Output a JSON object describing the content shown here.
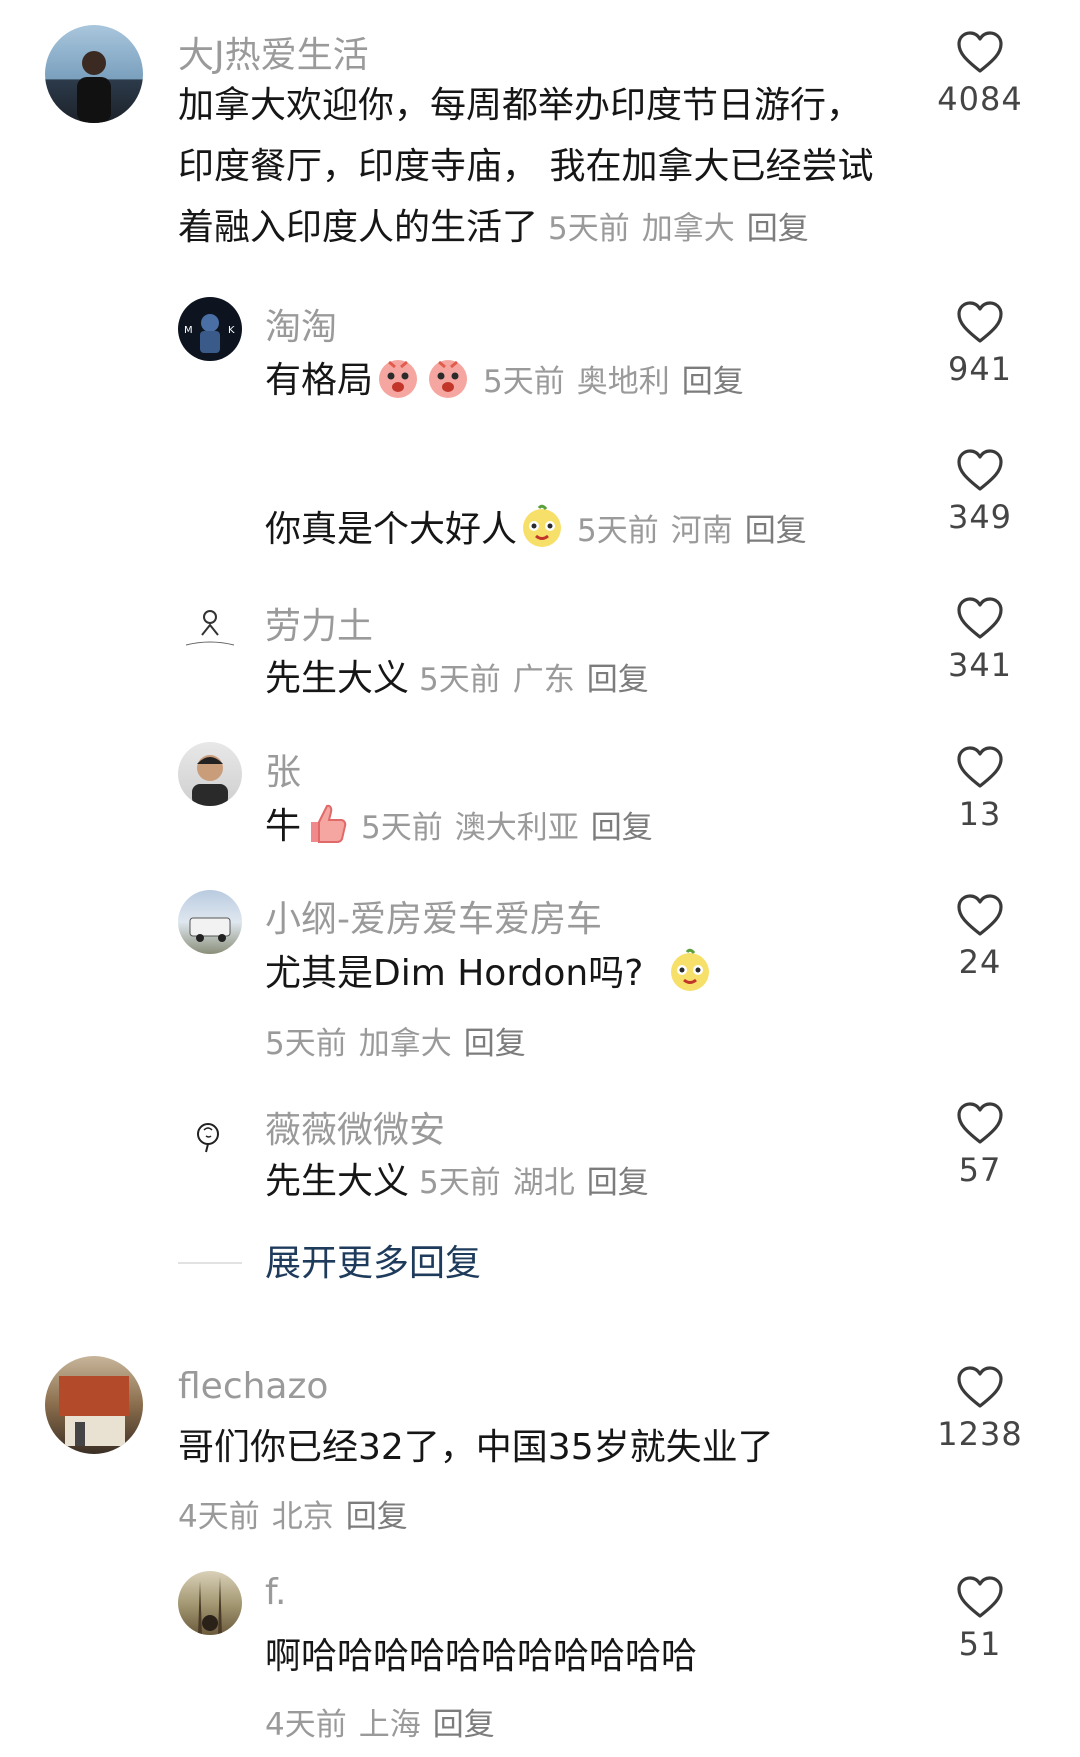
{
  "comments": [
    {
      "user": "大J热爱生活",
      "lines": [
        "加拿大欢迎你，每周都举办印度节日游行，",
        "印度餐厅，印度寺庙， 我在加拿大已经尝试",
        "着融入印度人的生活了"
      ],
      "time": "5天前",
      "location": "加拿大",
      "reply": "回复",
      "likes": "4084",
      "avatar_icon": "man-by-sea-avatar"
    },
    {
      "user": "淘淘",
      "text": "有格局",
      "emojis": [
        "angry-face-emoji",
        "angry-face-emoji"
      ],
      "time": "5天前",
      "location": "奥地利",
      "reply": "回复",
      "likes": "941",
      "avatar_icon": "soldier-mk-avatar"
    },
    {
      "user": "",
      "text": "你真是个大好人",
      "emojis": [
        "smug-face-emoji"
      ],
      "time": "5天前",
      "location": "河南",
      "reply": "回复",
      "likes": "349"
    },
    {
      "user": "劳力土",
      "text": "先生大义",
      "time": "5天前",
      "location": "广东",
      "reply": "回复",
      "likes": "341",
      "avatar_icon": "sketch-figure-avatar"
    },
    {
      "user": "张",
      "text": "牛",
      "emojis": [
        "thumbs-up-emoji"
      ],
      "time": "5天前",
      "location": "澳大利亚",
      "reply": "回复",
      "likes": "13",
      "avatar_icon": "man-portrait-avatar"
    },
    {
      "user": "小纲-爱房爱车爱房车",
      "text": "尤其是Dim Hordon吗?",
      "emojis": [
        "smug-face-emoji"
      ],
      "time": "5天前",
      "location": "加拿大",
      "reply": "回复",
      "likes": "24",
      "avatar_icon": "rv-truck-avatar"
    },
    {
      "user": "薇薇微微安",
      "text": "先生大义",
      "time": "5天前",
      "location": "湖北",
      "reply": "回复",
      "likes": "57",
      "avatar_icon": "brain-sketch-avatar"
    },
    {
      "user": "flechazo",
      "text": "哥们你已经32了，中国35岁就失业了",
      "time": "4天前",
      "location": "北京",
      "reply": "回复",
      "likes": "1238",
      "avatar_icon": "storefront-avatar"
    },
    {
      "user": "f.",
      "text": "啊哈哈哈哈哈哈哈哈哈哈哈",
      "time": "4天前",
      "location": "上海",
      "reply": "回复",
      "likes": "51",
      "avatar_icon": "forest-avatar"
    }
  ],
  "expand_replies": "展开更多回复",
  "colors": {
    "username": "#9a9a9a",
    "text": "#161616",
    "meta": "#9a9a9a",
    "expand": "#1f3b5c"
  }
}
